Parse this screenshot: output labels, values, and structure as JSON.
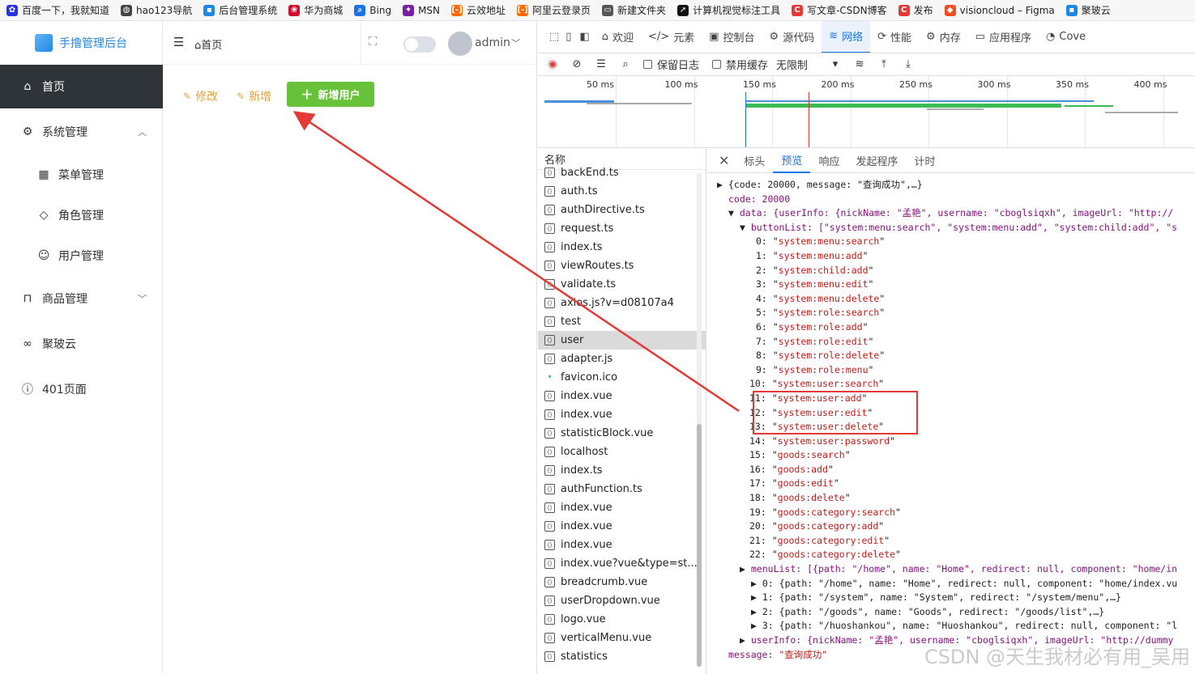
{
  "bookmarks": [
    {
      "label": "百度一下，我就知道",
      "color": "#2932e1",
      "icon": "baidu-paw-icon"
    },
    {
      "label": "hao123导航",
      "color": "#444444",
      "icon": "globe-icon"
    },
    {
      "label": "后台管理系统",
      "color": "#1e88e5",
      "icon": "app-square-icon"
    },
    {
      "label": "华为商城",
      "color": "#cf0a2c",
      "icon": "huawei-logo-icon"
    },
    {
      "label": "Bing",
      "color": "#1a73e8",
      "icon": "search-icon"
    },
    {
      "label": "MSN",
      "color": "#7b1fa2",
      "icon": "msn-butterfly-icon"
    },
    {
      "label": "云效地址",
      "color": "#ff6a00",
      "icon": "aliyun-icon"
    },
    {
      "label": "阿里云登录页",
      "color": "#ff6a00",
      "icon": "aliyun-icon"
    },
    {
      "label": "新建文件夹",
      "color": "#555555",
      "icon": "folder-icon"
    },
    {
      "label": "计算机视觉标注工具",
      "color": "#111111",
      "icon": "compass-icon"
    },
    {
      "label": "写文章-CSDN博客",
      "color": "#e53935",
      "icon": "csdn-c-icon"
    },
    {
      "label": "发布",
      "color": "#e53935",
      "icon": "csdn-c-icon"
    },
    {
      "label": "visioncloud – Figma",
      "color": "#f24e1e",
      "icon": "figma-icon"
    },
    {
      "label": "聚玻云",
      "color": "#1e88e5",
      "icon": "app-square-icon"
    }
  ],
  "app": {
    "logo_text": "手撸管理后台",
    "breadcrumb": "首页",
    "username": "admin",
    "menu": [
      {
        "label": "首页",
        "icon": "home-icon",
        "active": true
      },
      {
        "label": "系统管理",
        "icon": "gear-icon",
        "expanded": true
      },
      {
        "label": "菜单管理",
        "icon": "grid-icon"
      },
      {
        "label": "角色管理",
        "icon": "diamond-icon"
      },
      {
        "label": "用户管理",
        "icon": "user-icon"
      },
      {
        "label": "商品管理",
        "icon": "bag-icon"
      },
      {
        "label": "聚玻云",
        "icon": "link-icon"
      },
      {
        "label": "401页面",
        "icon": "warning-circle-icon"
      }
    ],
    "actions": {
      "edit": "修改",
      "add": "新增",
      "add_user": "新增用户"
    }
  },
  "devtools": {
    "tabs": [
      "欢迎",
      "元素",
      "控制台",
      "源代码",
      "网络",
      "性能",
      "内存",
      "应用程序",
      "Cove"
    ],
    "active_tab": "网络",
    "toolbar": {
      "preserve_log": "保留日志",
      "disable_cache": "禁用缓存",
      "throttle": "无限制"
    },
    "timeline_ticks": [
      "50 ms",
      "100 ms",
      "150 ms",
      "200 ms",
      "250 ms",
      "300 ms",
      "350 ms",
      "400 ms"
    ],
    "name_header": "名称",
    "requests": [
      "backEnd.ts",
      "auth.ts",
      "authDirective.ts",
      "request.ts",
      "index.ts",
      "viewRoutes.ts",
      "validate.ts",
      "axios.js?v=d08107a4",
      "test",
      "user",
      "adapter.js",
      "favicon.ico",
      "index.vue",
      "index.vue",
      "statisticBlock.vue",
      "localhost",
      "index.ts",
      "authFunction.ts",
      "index.vue",
      "index.vue",
      "index.vue",
      "index.vue?vue&type=st...",
      "breadcrumb.vue",
      "userDropdown.vue",
      "logo.vue",
      "verticalMenu.vue",
      "statistics"
    ],
    "selected_request": "user",
    "detail_tabs": [
      "标头",
      "预览",
      "响应",
      "发起程序",
      "计时"
    ],
    "active_detail_tab": "预览",
    "preview": {
      "root_line": "{code: 20000, message: \"查询成功\",…}",
      "code_line": "code: 20000",
      "data_line": "data: {userInfo: {nickName: \"孟艳\", username: \"cboglsiqxh\", imageUrl: \"http://",
      "buttonList_line": "buttonList: [\"system:menu:search\", \"system:menu:add\", \"system:child:add\", \"s",
      "buttons": [
        "system:menu:search",
        "system:menu:add",
        "system:child:add",
        "system:menu:edit",
        "system:menu:delete",
        "system:role:search",
        "system:role:add",
        "system:role:edit",
        "system:role:delete",
        "system:role:menu",
        "system:user:search",
        "system:user:add",
        "system:user:edit",
        "system:user:delete",
        "system:user:password",
        "goods:search",
        "goods:add",
        "goods:edit",
        "goods:delete",
        "goods:category:search",
        "goods:category:add",
        "goods:category:edit",
        "goods:category:delete"
      ],
      "menuList_line": "menuList: [{path: \"/home\", name: \"Home\", redirect: null, component: \"home/in",
      "menu_items": [
        "0: {path: \"/home\", name: \"Home\", redirect: null, component: \"home/index.vu",
        "1: {path: \"/system\", name: \"System\", redirect: \"/system/menu\",…}",
        "2: {path: \"/goods\", name: \"Goods\", redirect: \"/goods/list\",…}",
        "3: {path: \"/huoshankou\", name: \"Huoshankou\", redirect: null, component: \"l"
      ],
      "userInfo_line": "userInfo: {nickName: \"孟艳\", username: \"cboglsiqxh\", imageUrl: \"http://dummy",
      "message_key": "message: ",
      "message_value": "\"查询成功\""
    }
  },
  "watermark": "CSDN @天生我材必有用_吴用",
  "colors": {
    "accent_green": "#67c23a",
    "warning_orange": "#e6a23c",
    "highlight_red": "#e53935",
    "devtools_blue": "#1a73e8"
  }
}
